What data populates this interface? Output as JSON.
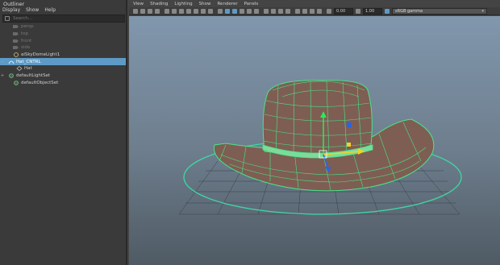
{
  "outliner": {
    "title": "Outliner",
    "menu": [
      "Display",
      "Show",
      "Help"
    ],
    "search_placeholder": "Search...",
    "items": [
      {
        "label": "persp",
        "type": "camera",
        "dim": true
      },
      {
        "label": "top",
        "type": "camera",
        "dim": true
      },
      {
        "label": "front",
        "type": "camera",
        "dim": true
      },
      {
        "label": "side",
        "type": "camera",
        "dim": true
      },
      {
        "label": "aiSkyDomeLight1",
        "type": "light",
        "dim": false
      },
      {
        "label": "Hat_CNTRL",
        "type": "curve",
        "dim": false,
        "selected": true
      },
      {
        "label": "Hat",
        "type": "mesh",
        "dim": false
      },
      {
        "label": "defaultLightSet",
        "type": "set",
        "dim": false
      },
      {
        "label": "defaultObjectSet",
        "type": "set",
        "dim": false
      }
    ]
  },
  "viewport": {
    "menu": [
      "View",
      "Shading",
      "Lighting",
      "Show",
      "Renderer",
      "Panels"
    ],
    "exposure": "0.00",
    "gamma": "1.00",
    "color_space": "sRGB gamma"
  },
  "colors": {
    "selection": "#5d9bc6",
    "wire": "#47e58a",
    "hat": "#7e5e52"
  }
}
